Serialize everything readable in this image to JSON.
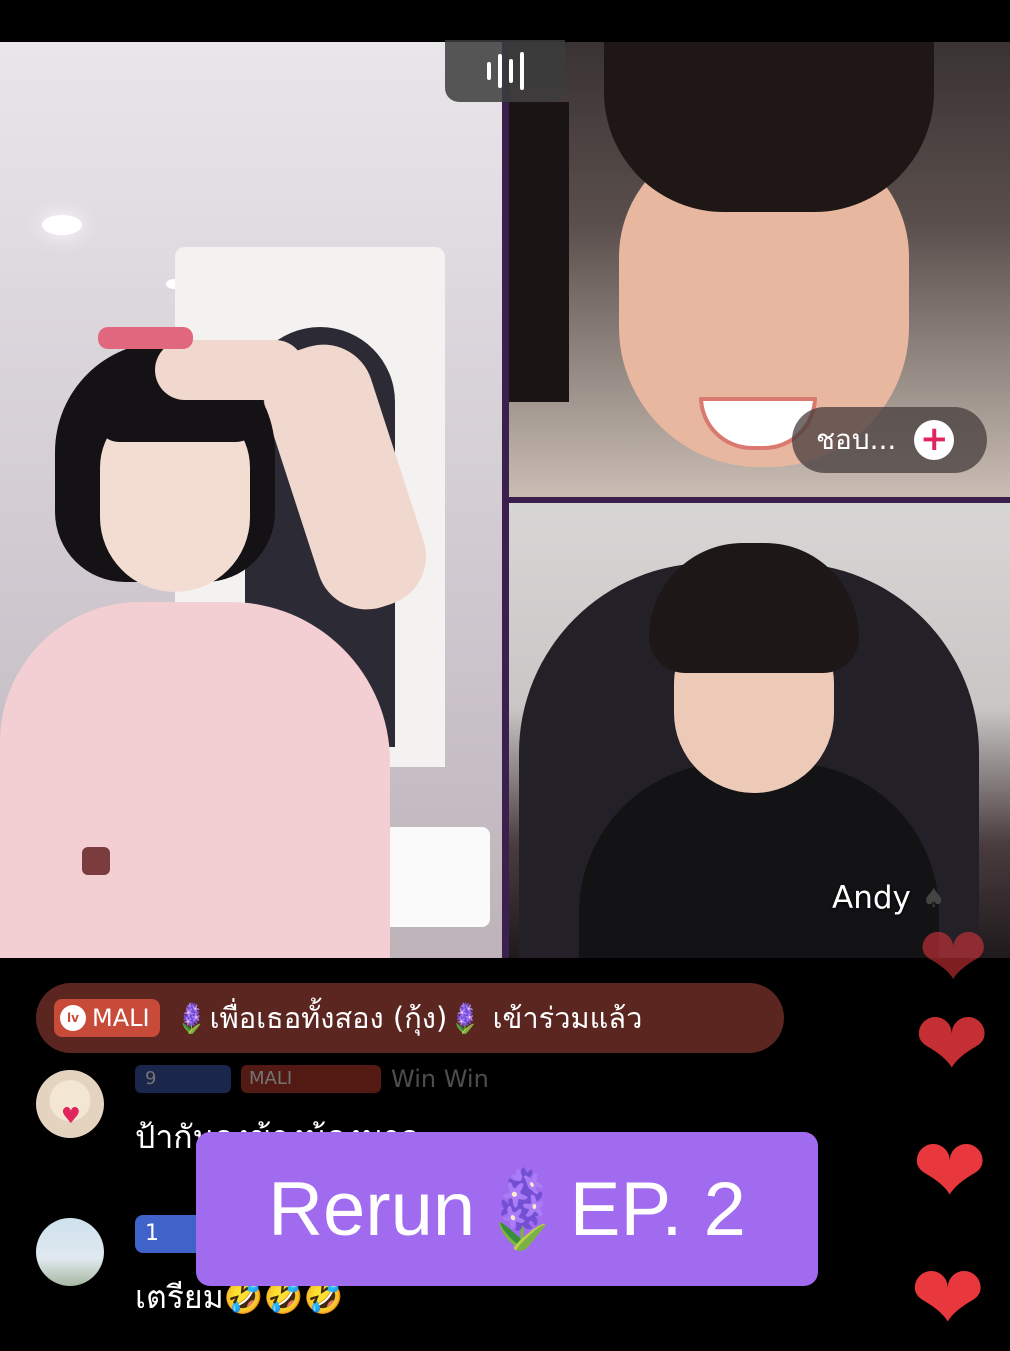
{
  "audio_indicator": {
    "icon": "audio-bars-icon"
  },
  "like_pill": {
    "label": "ชอบ...",
    "action_icon": "+"
  },
  "guest_name": "Andy",
  "guest_badge_icon": "♠",
  "join_banner": {
    "level_badge": "lv",
    "badge_label": "MALI",
    "text": "🪻เพื่อเธอทั้งสอง (กุ้ง)🪻 เข้าร่วมแล้ว"
  },
  "comments": [
    {
      "level": "9",
      "tag": "MALI",
      "username": "Win Win",
      "text": "ป้ากันองข้างน้องมาจะ"
    },
    {
      "level": "1",
      "text": "เตรียม🤣🤣🤣"
    }
  ],
  "title_overlay": "Rerun🪻EP. 2",
  "floating_heart_glyph": "❤",
  "colors": {
    "title_bg": "#a16bf0",
    "banner_bg": "#5b2520",
    "heart": "#e8373d",
    "divider": "#3b1f4d"
  }
}
